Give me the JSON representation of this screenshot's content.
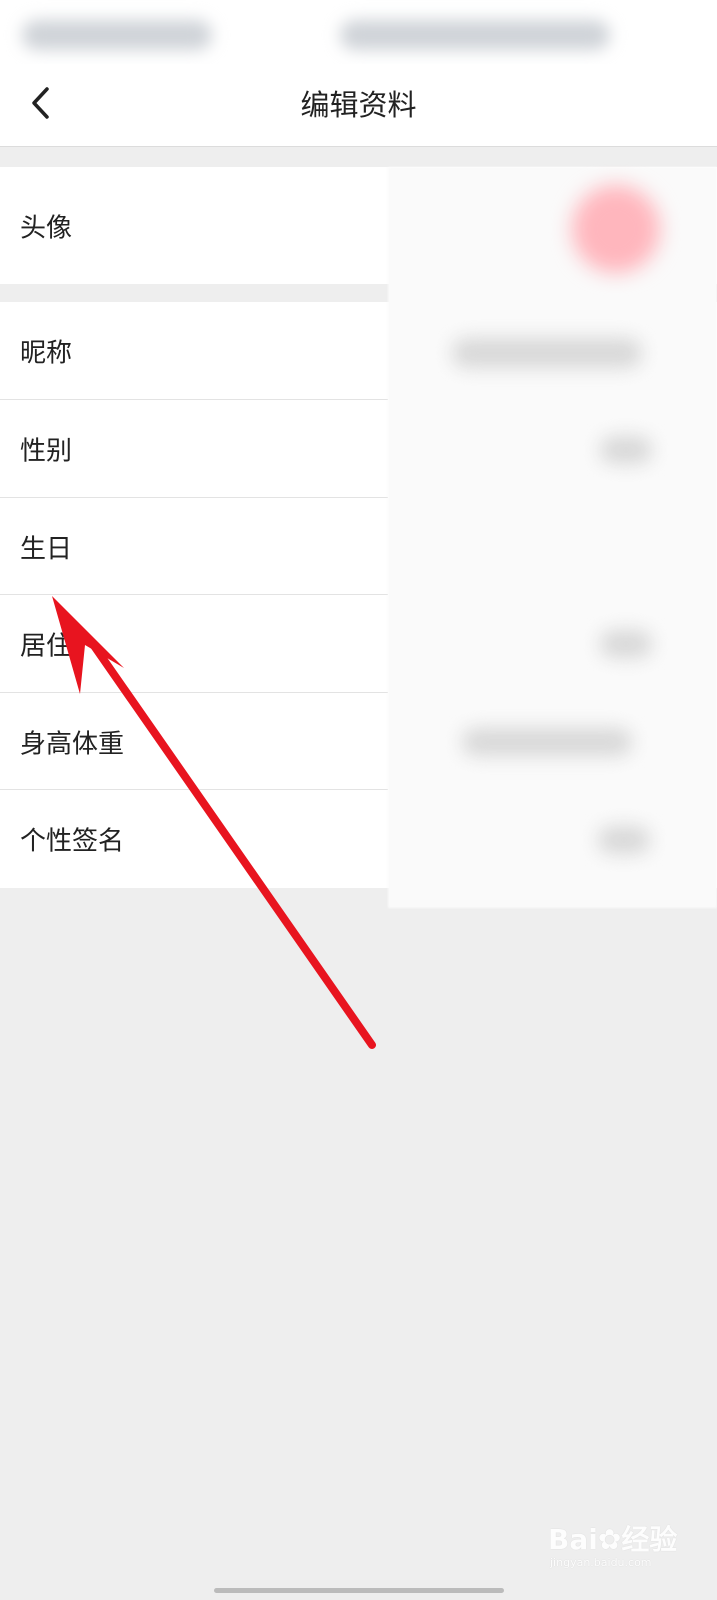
{
  "header": {
    "title": "编辑资料",
    "back_icon": "chevron-left-icon"
  },
  "profile": {
    "avatar_label": "头像",
    "rows": [
      {
        "label": "昵称"
      },
      {
        "label": "性别"
      },
      {
        "label": "生日"
      },
      {
        "label": "居住"
      },
      {
        "label": "身高体重"
      },
      {
        "label": "个性签名"
      }
    ]
  },
  "annotation": {
    "arrow_color": "#e8141f",
    "points_to": "生日"
  },
  "watermark": {
    "brand": "Bai",
    "brand_suffix": "经验",
    "site": "jingyan.baidu.com"
  },
  "colors": {
    "background": "#eeeeee",
    "row_background": "#ffffff",
    "text": "#222222",
    "divider": "#e3e3e3"
  }
}
